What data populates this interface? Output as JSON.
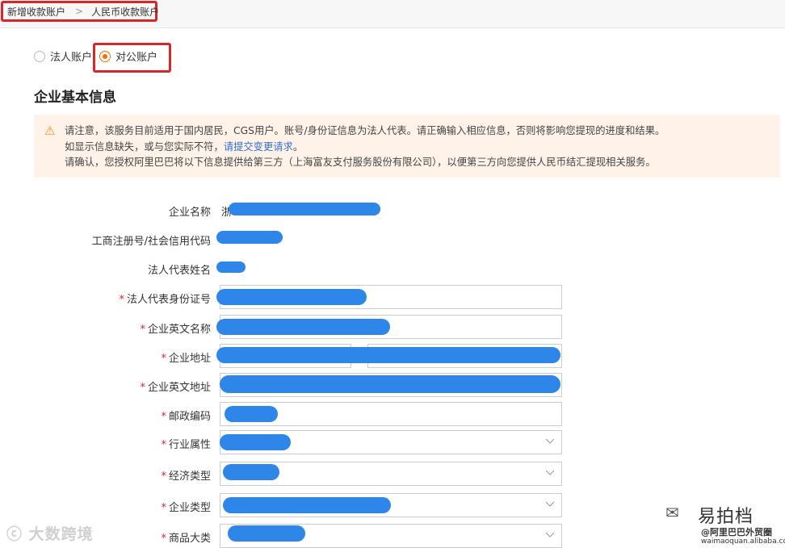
{
  "breadcrumb": {
    "item1": "新增收款账户",
    "separator": ">",
    "item2": "人民币收款账户"
  },
  "account_type": {
    "options": [
      {
        "label": "法人账户",
        "selected": false
      },
      {
        "label": "对公账户",
        "selected": true
      }
    ]
  },
  "section_title": "企业基本信息",
  "notice": {
    "line1": "请注意，该服务目前适用于国内居民，CGS用户。账号/身份证信息为法人代表。请正确输入相应信息，否则将影响您提现的进度和结果。",
    "line2_prefix": "如显示信息缺失，或与您实际不符，",
    "line2_link": "请提交变更请求",
    "line2_suffix": "。",
    "line3": "请确认，您授权阿里巴巴将以下信息提供给第三方（上海富友支付服务股份有限公司），以便第三方向您提供人民币结汇提现相关服务。"
  },
  "form": {
    "company_name": {
      "label": "企业名称",
      "value_prefix": "浙"
    },
    "registration_code": {
      "label": "工商注册号/社会信用代码"
    },
    "legal_rep_name": {
      "label": "法人代表姓名"
    },
    "legal_rep_id": {
      "label": "法人代表身份证号",
      "required": "*"
    },
    "company_en_name": {
      "label": "企业英文名称",
      "required": "*"
    },
    "company_address": {
      "label": "企业地址",
      "required": "*"
    },
    "company_en_address": {
      "label": "企业英文地址",
      "required": "*"
    },
    "postal_code": {
      "label": "邮政编码",
      "required": "*"
    },
    "industry": {
      "label": "行业属性",
      "required": "*"
    },
    "economic_type": {
      "label": "经济类型",
      "required": "*"
    },
    "company_type": {
      "label": "企业类型",
      "required": "*"
    },
    "product_category": {
      "label": "商品大类",
      "required": "*"
    }
  },
  "watermark": {
    "left": "大数跨境",
    "right_title": "易拍档",
    "right_sub1": "@阿里巴巴外贸圈",
    "right_sub2": "waimaoquan.alibaba.com"
  },
  "colors": {
    "accent": "#ff6a00",
    "highlight_box": "#d9262c",
    "link": "#2f6fd6",
    "redaction": "#2e86e8"
  }
}
